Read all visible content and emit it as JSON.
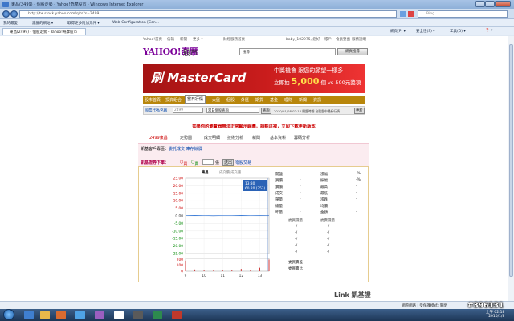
{
  "window": {
    "title": "東昌(2499) - 個股走勢 - Yahoo!奇摩股市 - Windows Internet Explorer"
  },
  "address": {
    "url": "http://tw.stock.yahoo.com/q/ts?s=2499",
    "search_placeholder": "Bing"
  },
  "favorites": {
    "label": "我的最愛",
    "items": [
      "建議的網站 ▾",
      "取得更多附加元件 ▾",
      "Web Configuration [Con..."
    ]
  },
  "tab": {
    "label": "東昌(2499) - 個股走勢 - Yahoo!奇摩股市"
  },
  "commands": {
    "page": "網頁(P) ▾",
    "safety": "安全性(S) ▾",
    "tools": "工具(O) ▾",
    "help": "❓ ▾"
  },
  "yahoo": {
    "toplinks": [
      "Yahoo!首頁",
      "信箱",
      "新聞",
      "更多 ▾"
    ],
    "greeting": "財經服務首頁",
    "user": "baby_102975, 您好",
    "account": "帳戶",
    "links2": [
      "會員登出",
      "服務說明"
    ],
    "logo": "YAHOO!奇摩",
    "logo_sub": "股市",
    "search_label": "搜尋",
    "search_button": "網頁搜尋"
  },
  "banner": {
    "brand": "刷 MasterCard",
    "line1": "中獎機會 跟您的願望一樣多",
    "line2_prefix": "立即抽",
    "line2_amount": "5,000",
    "line2_suffix": "個 vs 500元獎項"
  },
  "nav": {
    "tabs": [
      "股市首頁",
      "投資組合",
      "當日行情",
      "大盤",
      "個股",
      "外匯",
      "期貨",
      "基金",
      "理財",
      "新聞",
      "資訊"
    ],
    "active_index": 2
  },
  "searchrow": {
    "label": "股票代號/名稱",
    "value": "2499",
    "select": "當日個股查詢",
    "button": "查詢",
    "time": "2010/01/08 02:18 開盤時間 台股盤中最新行情",
    "button2": "更新"
  },
  "warning": "如果你的瀏覽器無法正常顯示線圖，請點這裡，立即下載更新版本",
  "subnav": [
    "2499東昌",
    "走勢圖",
    "成交明細",
    "技術分析",
    "新聞",
    "基本資料",
    "籌碼分析"
  ],
  "notice": {
    "label": "凱基客戶專區：",
    "link1": "委託成交",
    "link2": "庫存餘價"
  },
  "order": {
    "label": "凱基證券下單：",
    "buy": "買",
    "sell": "賣",
    "unit": "張",
    "button": "送出",
    "link": "零股交易"
  },
  "chart_data": {
    "type": "line",
    "stock": "東昌",
    "subtitle": "成交價  成交量",
    "x_ticks": [
      "9",
      "10",
      "11",
      "12",
      "13"
    ],
    "y_ticks": [
      "25.00",
      "20.00",
      "15.00",
      "10.00",
      "5.00",
      "0.00",
      "-5.00",
      "-10.00",
      "-15.00",
      "-20.00",
      "-25.00"
    ],
    "volume_ticks": [
      "200",
      "100",
      "0"
    ],
    "tooltip": {
      "time": "13:30",
      "value": "60.20 (353)"
    },
    "price_x": [
      9.0,
      9.5,
      10,
      10.5,
      11,
      11.5,
      12,
      12.5,
      13,
      13.5
    ],
    "price_y": [
      0.2,
      0.3,
      0.2,
      0.1,
      0.2,
      0.2,
      0.3,
      0.2,
      0.3,
      0.4
    ],
    "volume": [
      180,
      30,
      20,
      10,
      15,
      20,
      40,
      25,
      60,
      200
    ],
    "ylim": [
      -25,
      25
    ],
    "volume_lim": [
      0,
      220
    ]
  },
  "quote": {
    "rows": [
      {
        "label": "開盤",
        "value": "-",
        "label2": "漲幅",
        "value2": "-%"
      },
      {
        "label": "買價",
        "value": "-",
        "label2": "振幅",
        "value2": "-%"
      },
      {
        "label": "賣價",
        "value": "-",
        "label2": "最高",
        "value2": "-"
      },
      {
        "label": "成交",
        "value": "-",
        "label2": "最低",
        "value2": "-"
      },
      {
        "label": "單量",
        "value": "-",
        "label2": "漲跌",
        "value2": "-"
      },
      {
        "label": "總量",
        "value": "-",
        "label2": "均價",
        "value2": "-"
      },
      {
        "label": "昨量",
        "value": "-",
        "label2": "金額",
        "value2": "-"
      }
    ],
    "book_headers": [
      "委買價量",
      "委賣價量"
    ],
    "book_rows": [
      "-/",
      "-/",
      "-/",
      "-/",
      "-/"
    ],
    "totals": [
      "委買賣差",
      "委買賣比"
    ]
  },
  "footer": {
    "brand": "Link 凱基證"
  },
  "status": {
    "zone": "網際網路 | 受保護模式: 關閉",
    "zoom": "100% ▾"
  },
  "taskbar": {
    "time": "上午 02:18",
    "date": "2010/1/8"
  },
  "watermark": "#396131"
}
